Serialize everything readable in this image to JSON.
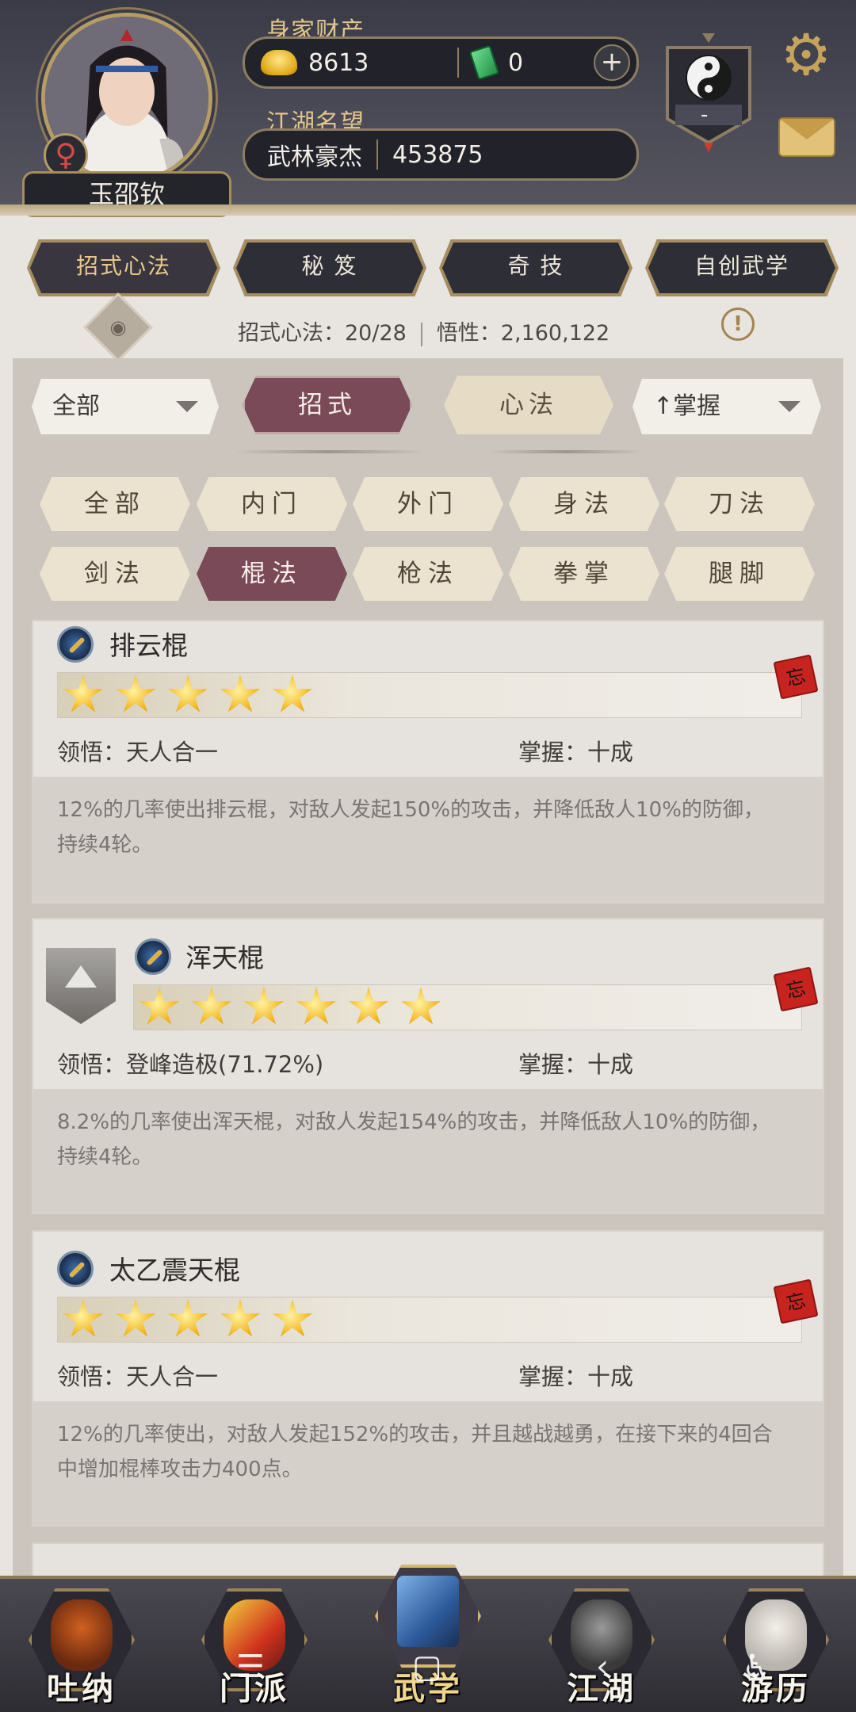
{
  "header": {
    "player_name": "玉邵钦",
    "gender_symbol": "♀",
    "wealth_label": "身家财产",
    "gold_amount": "8613",
    "jade_amount": "0",
    "plus_symbol": "+",
    "reputation_label": "江湖名望",
    "reputation_title": "武林豪杰",
    "reputation_value": "453875",
    "sect_badge_value": "-"
  },
  "category_tabs": [
    "招式心法",
    "秘 笈",
    "奇 技",
    "自创武学"
  ],
  "stats": {
    "moves_label": "招式心法：20/28",
    "insight_label": "悟性：2,160,122"
  },
  "filters": {
    "scope_dropdown": "全部",
    "mode_moves": "招式",
    "mode_mind": "心法",
    "sort_dropdown": "↑掌握",
    "chips_row1": [
      "全部",
      "内门",
      "外门",
      "身法",
      "刀法"
    ],
    "chips_row2": [
      "剑法",
      "棍法",
      "枪法",
      "拳掌",
      "腿脚"
    ],
    "active_chip": "棍法"
  },
  "skills": [
    {
      "name": "排云棍",
      "stars": 5,
      "insight": "领悟：天人合一",
      "mastery": "掌握：十成",
      "description": "12%的几率使出排云棍，对敌人发起150%的攻击，并降低敌人10%的防御，持续4轮。",
      "forget_label": "忘"
    },
    {
      "name": "浑天棍",
      "stars": 6,
      "insight": "领悟：登峰造极(71.72%)",
      "mastery": "掌握：十成",
      "description": "8.2%的几率使出浑天棍，对敌人发起154%的攻击，并降低敌人10%的防御，持续4轮。",
      "forget_label": "忘"
    },
    {
      "name": "太乙震天棍",
      "stars": 5,
      "insight": "领悟：天人合一",
      "mastery": "掌握：十成",
      "description": "12%的几率使出，对敌人发起152%的攻击，并且越战越勇，在接下来的4回合中增加棍棒攻击力400点。",
      "forget_label": "忘"
    }
  ],
  "bottom_nav": [
    "吐纳",
    "门派",
    "武学",
    "江湖",
    "游历"
  ],
  "colors": {
    "accent_gold": "#e3c68b",
    "active_chip": "#7a4a58",
    "header_bg": "#3b3b47"
  }
}
